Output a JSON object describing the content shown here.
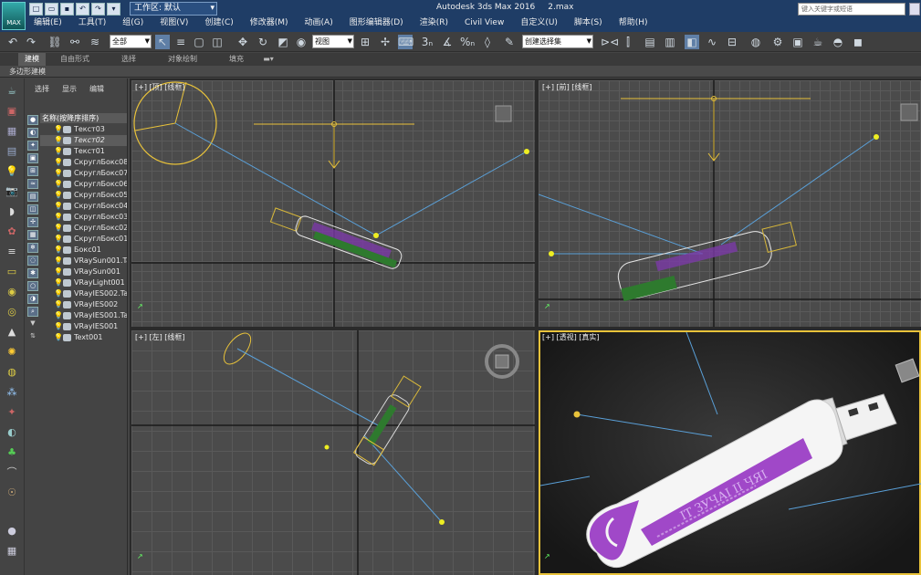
{
  "app": {
    "icon_label": "MAX",
    "title": "Autodesk 3ds Max 2016",
    "file": "2.max"
  },
  "quick_access": {
    "buttons": [
      "new-icon",
      "open-icon",
      "save-icon",
      "undo-icon",
      "redo-icon",
      "menu-icon"
    ]
  },
  "workspace": {
    "label": "工作区: 默认"
  },
  "search": {
    "placeholder": "键入关键字或短语"
  },
  "menu": [
    "编辑(E)",
    "工具(T)",
    "组(G)",
    "视图(V)",
    "创建(C)",
    "修改器(M)",
    "动画(A)",
    "图形编辑器(D)",
    "渲染(R)",
    "Civil View",
    "自定义(U)",
    "脚本(S)",
    "帮助(H)"
  ],
  "toolbar": {
    "selection_filter": "全部",
    "reference_coord": "视图",
    "named_selection": "创建选择集"
  },
  "ribbon": {
    "tabs": [
      "建模",
      "自由形式",
      "选择",
      "对象绘制",
      "填充"
    ],
    "active_tab": "建模",
    "sub_label": "多边形建模"
  },
  "explorer": {
    "tabs": [
      "选择",
      "显示",
      "编辑"
    ],
    "header": "名称(按降序排序)",
    "items": [
      {
        "name": "Текст03",
        "italic": false,
        "selected": false
      },
      {
        "name": "Текст02",
        "italic": true,
        "selected": true
      },
      {
        "name": "Текст01",
        "italic": false,
        "selected": false
      },
      {
        "name": "СкруглБокс08",
        "italic": false,
        "selected": false
      },
      {
        "name": "СкруглБокс07",
        "italic": false,
        "selected": false
      },
      {
        "name": "СкруглБокс06",
        "italic": false,
        "selected": false
      },
      {
        "name": "СкруглБокс05",
        "italic": false,
        "selected": false
      },
      {
        "name": "СкруглБокс04",
        "italic": false,
        "selected": false
      },
      {
        "name": "СкруглБокс03",
        "italic": false,
        "selected": false
      },
      {
        "name": "СкруглБокс02",
        "italic": false,
        "selected": false
      },
      {
        "name": "СкруглБокс01",
        "italic": false,
        "selected": false
      },
      {
        "name": "Бокс01",
        "italic": false,
        "selected": false
      },
      {
        "name": "VRaySun001.Ta",
        "italic": false,
        "selected": false
      },
      {
        "name": "VRaySun001",
        "italic": false,
        "selected": false
      },
      {
        "name": "VRayLight001",
        "italic": false,
        "selected": false
      },
      {
        "name": "VRayIES002.Ta",
        "italic": false,
        "selected": false
      },
      {
        "name": "VRayIES002",
        "italic": false,
        "selected": false
      },
      {
        "name": "VRayIES001.Ta",
        "italic": false,
        "selected": false
      },
      {
        "name": "VRayIES001",
        "italic": false,
        "selected": false
      },
      {
        "name": "Text001",
        "italic": false,
        "selected": false
      }
    ]
  },
  "viewports": {
    "top_left": {
      "label": "[+] [顶] [线框]"
    },
    "top_right": {
      "label": "[+] [前] [线框]"
    },
    "bottom_left": {
      "label": "[+] [左] [线框]"
    },
    "bottom_right": {
      "label": "[+] [透视] [真实]"
    }
  },
  "model": {
    "logo_text": "IT ЗУЧАІ ІІ ЧЯІ"
  },
  "colors": {
    "accent": "#e8c23a",
    "model_purple": "#a048c8",
    "model_white": "#f2f2f2",
    "light_line": "#5aa0d8"
  }
}
